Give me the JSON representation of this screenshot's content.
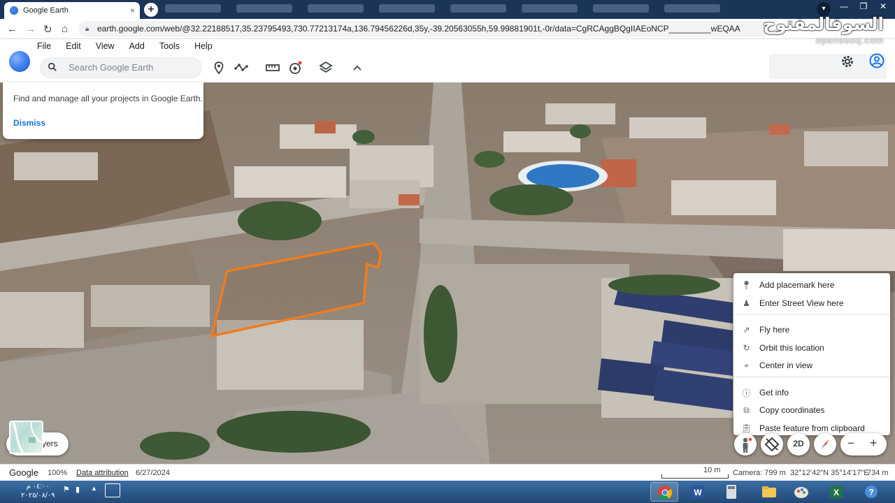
{
  "browser": {
    "tab_title": "Google Earth",
    "tab_close": "×",
    "new_tab": "+",
    "url": "earth.google.com/web/@32.22188517,35.23795493,730.77213174a,136.79456226d,35y,-39.20563055h,59.99881901t,-0r/data=CgRCAggBQgIIAEoNCP_________wEQAA",
    "window_controls": [
      "—",
      "❐",
      "✕"
    ],
    "nav_icons": [
      "back-icon",
      "forward-icon",
      "reload-icon",
      "home-icon"
    ]
  },
  "watermark": {
    "line1": "السوقالمفتوح",
    "line2": "opensooq.com"
  },
  "app_menu": {
    "items": [
      "File",
      "Edit",
      "View",
      "Add",
      "Tools",
      "Help"
    ]
  },
  "search": {
    "placeholder": "Search Google Earth"
  },
  "toolbar_icons": [
    "placemark-icon",
    "path-icon",
    "measure-icon",
    "voyager-icon",
    "layers-style-icon",
    "collapse-icon"
  ],
  "popup": {
    "message": "Find and manage all your projects in Google Earth.",
    "dismiss": "Dismiss"
  },
  "context_menu": {
    "items": [
      {
        "label": "Add placemark here",
        "icon": "add-placemark-icon"
      },
      {
        "label": "Enter Street View here",
        "icon": "street-view-icon"
      },
      {
        "label": "Fly here",
        "icon": "fly-icon"
      },
      {
        "label": "Orbit this location",
        "icon": "orbit-icon"
      },
      {
        "label": "Center in view",
        "icon": "center-icon"
      },
      {
        "label": "Get info",
        "icon": "info-icon"
      },
      {
        "label": "Copy coordinates",
        "icon": "copy-icon"
      },
      {
        "label": "Paste feature from clipboard",
        "icon": "paste-icon"
      }
    ]
  },
  "layers": {
    "label": "Layers",
    "visible_label": "yers"
  },
  "map_controls": {
    "view_mode": "2D",
    "zoom_out": "−",
    "zoom_in": "+"
  },
  "status_bar": {
    "brand": "Google",
    "zoom": "100%",
    "attribution": "Data attribution",
    "date": "6/27/2024",
    "scale": "10 m",
    "camera": "Camera: 799 m",
    "coords": "32°12'42\"N 35°14'17\"E",
    "elevation": "734 m"
  },
  "taskbar": {
    "time": "٠٤:٠٠ م",
    "date": "٢٠٢٥/٠٨/٠٩",
    "apps": [
      "chrome-icon",
      "word-icon",
      "calculator-icon",
      "explorer-icon",
      "paint-icon",
      "excel-icon",
      "help-icon"
    ]
  },
  "colors": {
    "accent_blue": "#1a73e8",
    "parcel_outline": "#f07c1e",
    "taskbar": "#2c5a8c"
  }
}
